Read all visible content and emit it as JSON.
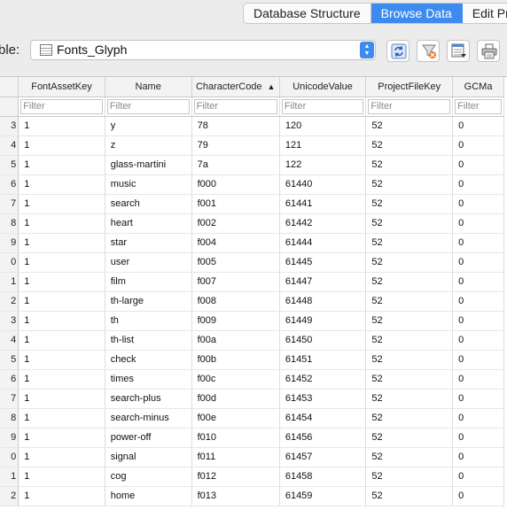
{
  "tabs": [
    {
      "label": "Database Structure",
      "active": false
    },
    {
      "label": "Browse Data",
      "active": true
    },
    {
      "label": "Edit Pra",
      "active": false
    }
  ],
  "toolbar": {
    "table_label": "ble:",
    "selected_table": "Fonts_Glyph",
    "icons": [
      "refresh-icon",
      "clear-filters-icon",
      "save-table-icon",
      "print-icon"
    ]
  },
  "grid": {
    "columns": [
      "FontAssetKey",
      "Name",
      "CharacterCode",
      "UnicodeValue",
      "ProjectFileKey",
      "GCMa"
    ],
    "sorted_column": "CharacterCode",
    "sort_direction": "ascending",
    "filter_placeholder": "Filter",
    "rows": [
      {
        "rownum": "3",
        "cells": [
          "1",
          "y",
          "78",
          "120",
          "52",
          "0"
        ]
      },
      {
        "rownum": "4",
        "cells": [
          "1",
          "z",
          "79",
          "121",
          "52",
          "0"
        ]
      },
      {
        "rownum": "5",
        "cells": [
          "1",
          "glass-martini",
          "7a",
          "122",
          "52",
          "0"
        ]
      },
      {
        "rownum": "6",
        "cells": [
          "1",
          "music",
          "f000",
          "61440",
          "52",
          "0"
        ]
      },
      {
        "rownum": "7",
        "cells": [
          "1",
          "search",
          "f001",
          "61441",
          "52",
          "0"
        ]
      },
      {
        "rownum": "8",
        "cells": [
          "1",
          "heart",
          "f002",
          "61442",
          "52",
          "0"
        ]
      },
      {
        "rownum": "9",
        "cells": [
          "1",
          "star",
          "f004",
          "61444",
          "52",
          "0"
        ]
      },
      {
        "rownum": "0",
        "cells": [
          "1",
          "user",
          "f005",
          "61445",
          "52",
          "0"
        ]
      },
      {
        "rownum": "1",
        "cells": [
          "1",
          "film",
          "f007",
          "61447",
          "52",
          "0"
        ]
      },
      {
        "rownum": "2",
        "cells": [
          "1",
          "th-large",
          "f008",
          "61448",
          "52",
          "0"
        ]
      },
      {
        "rownum": "3",
        "cells": [
          "1",
          "th",
          "f009",
          "61449",
          "52",
          "0"
        ]
      },
      {
        "rownum": "4",
        "cells": [
          "1",
          "th-list",
          "f00a",
          "61450",
          "52",
          "0"
        ]
      },
      {
        "rownum": "5",
        "cells": [
          "1",
          "check",
          "f00b",
          "61451",
          "52",
          "0"
        ]
      },
      {
        "rownum": "6",
        "cells": [
          "1",
          "times",
          "f00c",
          "61452",
          "52",
          "0"
        ]
      },
      {
        "rownum": "7",
        "cells": [
          "1",
          "search-plus",
          "f00d",
          "61453",
          "52",
          "0"
        ]
      },
      {
        "rownum": "8",
        "cells": [
          "1",
          "search-minus",
          "f00e",
          "61454",
          "52",
          "0"
        ]
      },
      {
        "rownum": "9",
        "cells": [
          "1",
          "power-off",
          "f010",
          "61456",
          "52",
          "0"
        ]
      },
      {
        "rownum": "0",
        "cells": [
          "1",
          "signal",
          "f011",
          "61457",
          "52",
          "0"
        ]
      },
      {
        "rownum": "1",
        "cells": [
          "1",
          "cog",
          "f012",
          "61458",
          "52",
          "0"
        ]
      },
      {
        "rownum": "2",
        "cells": [
          "1",
          "home",
          "f013",
          "61459",
          "52",
          "0"
        ]
      }
    ]
  }
}
